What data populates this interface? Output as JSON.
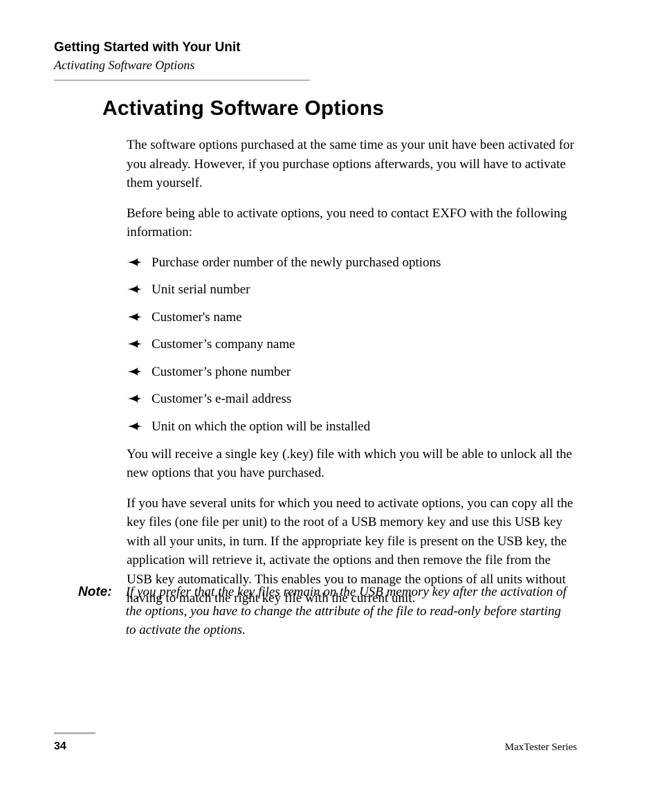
{
  "header": {
    "chapter": "Getting Started with Your Unit",
    "section": "Activating Software Options"
  },
  "heading": "Activating Software Options",
  "paragraphs": {
    "p1": "The software options purchased at the same time as your unit have been activated for you already. However, if you purchase options afterwards, you will have to activate them yourself.",
    "p2": "Before being able to activate options, you need to contact EXFO with the following information:",
    "p3": "You will receive a single key (.key) file with which you will be able to unlock all the new options that you have purchased.",
    "p4": "If you have several units for which you need to activate options, you can copy all the key files (one file per unit) to the root of a USB memory key and use this USB key with all your units, in turn. If the appropriate key file is present on the USB key, the application will retrieve it, activate the options and then remove the file from the USB key automatically. This enables you to manage the options of all units without having to match the right key file with the current unit."
  },
  "bullets": [
    "Purchase order number of the newly purchased options",
    "Unit serial number",
    "Customer's name",
    "Customer’s company name",
    "Customer’s phone number",
    "Customer’s e-mail address",
    "Unit on which the option will be installed"
  ],
  "note": {
    "label": "Note:",
    "text": "If you prefer that the key files remain on the USB memory key after the activation of the options, you have to change the attribute of the file to read-only before starting to activate the options."
  },
  "footer": {
    "page": "34",
    "series": "MaxTester Series"
  }
}
